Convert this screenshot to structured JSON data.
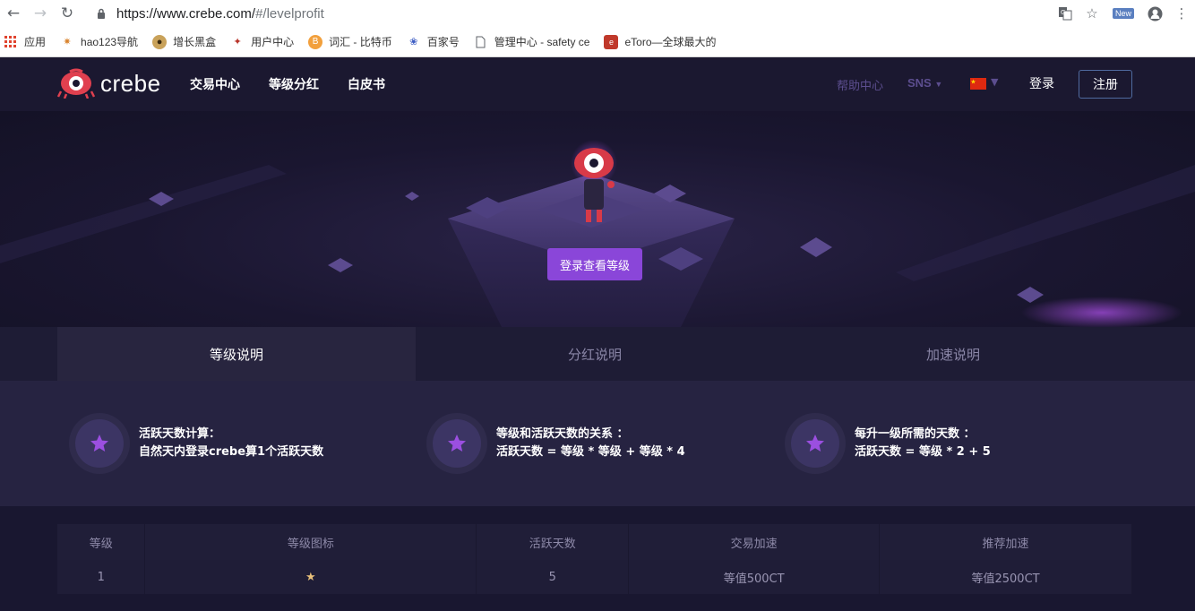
{
  "browser": {
    "url_prefix": "https://www.crebe.com/",
    "url_suffix": "#/levelprofit",
    "new_badge": "New",
    "bookmarks": [
      {
        "label": "应用",
        "icon": "apps-grid-icon"
      },
      {
        "label": "hao123导航",
        "icon": "hao123-icon"
      },
      {
        "label": "增长黑盒",
        "icon": "blackbox-icon"
      },
      {
        "label": "用户中心",
        "icon": "user-center-icon"
      },
      {
        "label": "词汇 - 比特币",
        "icon": "bitcoin-icon"
      },
      {
        "label": "百家号",
        "icon": "baidu-paw-icon"
      },
      {
        "label": "管理中心 - safety ce",
        "icon": "page-icon"
      },
      {
        "label": "eToro—全球最大的",
        "icon": "etoro-icon"
      }
    ]
  },
  "header": {
    "logo_text": "crebe",
    "nav": [
      "交易中心",
      "等级分红",
      "白皮书"
    ],
    "help": "帮助中心",
    "sns": "SNS",
    "login": "登录",
    "register": "注册"
  },
  "hero": {
    "button_label": "登录查看等级"
  },
  "tabs": [
    {
      "label": "等级说明",
      "active": true
    },
    {
      "label": "分红说明",
      "active": false
    },
    {
      "label": "加速说明",
      "active": false
    }
  ],
  "info": [
    {
      "title": "活跃天数计算：",
      "desc": "自然天内登录crebe算1个活跃天数"
    },
    {
      "title": "等级和活跃天数的关系 ：",
      "desc": "活跃天数 = 等级 * 等级 + 等级 * 4"
    },
    {
      "title": "每升一级所需的天数 ：",
      "desc": "活跃天数 = 等级 * 2 + 5"
    }
  ],
  "table": {
    "headers": [
      "等级",
      "等级图标",
      "活跃天数",
      "交易加速",
      "推荐加速"
    ],
    "rows": [
      {
        "level": "1",
        "stars": 1,
        "days": "5",
        "trade": "等值500CT",
        "referral": "等值2500CT"
      }
    ]
  },
  "colors": {
    "accent": "#8a46d9",
    "bg_dark": "#1b1830",
    "info_bg": "#262341"
  }
}
